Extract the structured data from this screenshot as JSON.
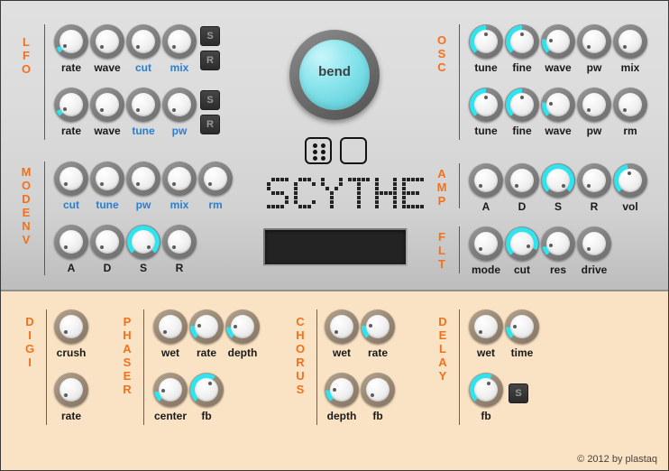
{
  "app": {
    "name": "SCYTHE",
    "logo_text": "SCYTHE",
    "copyright": "© 2012 by plastaq"
  },
  "colors": {
    "accent_orange": "#f4711c",
    "arc_cyan": "#2fe3ef",
    "mod_label_blue": "#2a7fd4",
    "top_panel_bg": "#dcdcdc",
    "bottom_panel_bg": "#fae3c4",
    "knob_ring_gray": "#808080",
    "knob_ring_tan": "#9b8a76",
    "bend_cyan": "#8fe6ee",
    "lcd_bg": "#232323"
  },
  "center": {
    "bend_label": "bend",
    "dice_button": "dice-icon",
    "blank_button": "square-icon",
    "lcd_text": ""
  },
  "sections": [
    {
      "id": "lfo",
      "label": "LFO",
      "panel": "top",
      "knobs": [
        {
          "label": "rate",
          "style": "plain",
          "value": 8,
          "angle": -125
        },
        {
          "label": "wave",
          "style": "plain",
          "value": 0,
          "angle": -135
        },
        {
          "label": "cut",
          "style": "mod",
          "value": 0,
          "angle": -135
        },
        {
          "label": "mix",
          "style": "mod",
          "value": 0,
          "angle": -135
        },
        {
          "label": "rate",
          "style": "plain",
          "value": 8,
          "angle": -125
        },
        {
          "label": "wave",
          "style": "plain",
          "value": 0,
          "angle": -135
        },
        {
          "label": "tune",
          "style": "mod",
          "value": 0,
          "angle": -135
        },
        {
          "label": "pw",
          "style": "mod",
          "value": 0,
          "angle": -135
        }
      ],
      "buttons": [
        "S",
        "R",
        "S",
        "R"
      ]
    },
    {
      "id": "mod-env",
      "label": "MOD ENV",
      "panel": "top",
      "knobs": [
        {
          "label": "cut",
          "style": "mod",
          "value": 0,
          "angle": -135
        },
        {
          "label": "tune",
          "style": "mod",
          "value": 0,
          "angle": -135
        },
        {
          "label": "pw",
          "style": "mod",
          "value": 0,
          "angle": -135
        },
        {
          "label": "mix",
          "style": "mod",
          "value": 0,
          "angle": -135
        },
        {
          "label": "rm",
          "style": "mod",
          "value": 0,
          "angle": -135
        },
        {
          "label": "A",
          "style": "plain",
          "value": 0,
          "angle": -135
        },
        {
          "label": "D",
          "style": "plain",
          "value": 0,
          "angle": -135
        },
        {
          "label": "S",
          "style": "plain",
          "value": 100,
          "angle": 135
        },
        {
          "label": "R",
          "style": "plain",
          "value": 0,
          "angle": -135
        }
      ],
      "buttons": []
    },
    {
      "id": "osc",
      "label": "OSC",
      "panel": "top",
      "knobs": [
        {
          "label": "tune",
          "style": "plain",
          "value": 50,
          "angle": 0
        },
        {
          "label": "fine",
          "style": "plain",
          "value": 50,
          "angle": 0
        },
        {
          "label": "wave",
          "style": "plain",
          "value": 20,
          "angle": -81
        },
        {
          "label": "pw",
          "style": "plain",
          "value": 0,
          "angle": -135
        },
        {
          "label": "mix",
          "style": "plain",
          "value": 0,
          "angle": -135
        },
        {
          "label": "tune",
          "style": "plain",
          "value": 50,
          "angle": 0
        },
        {
          "label": "fine",
          "style": "plain",
          "value": 50,
          "angle": 0
        },
        {
          "label": "wave",
          "style": "plain",
          "value": 20,
          "angle": -81
        },
        {
          "label": "pw",
          "style": "plain",
          "value": 0,
          "angle": -135
        },
        {
          "label": "rm",
          "style": "plain",
          "value": 0,
          "angle": -135
        }
      ],
      "buttons": []
    },
    {
      "id": "amp",
      "label": "AMP",
      "panel": "top",
      "knobs": [
        {
          "label": "A",
          "style": "plain",
          "value": 0,
          "angle": -135
        },
        {
          "label": "D",
          "style": "plain",
          "value": 0,
          "angle": -135
        },
        {
          "label": "S",
          "style": "plain",
          "value": 100,
          "angle": 135
        },
        {
          "label": "R",
          "style": "plain",
          "value": 0,
          "angle": -135
        },
        {
          "label": "vol",
          "style": "plain",
          "value": 46,
          "angle": -11
        }
      ],
      "buttons": []
    },
    {
      "id": "flt",
      "label": "FLT",
      "panel": "top",
      "knobs": [
        {
          "label": "mode",
          "style": "plain",
          "value": 0,
          "angle": -135
        },
        {
          "label": "cut",
          "style": "plain",
          "value": 92,
          "angle": 113
        },
        {
          "label": "res",
          "style": "plain",
          "value": 12,
          "angle": -103
        },
        {
          "label": "drive",
          "style": "plain",
          "value": 0,
          "angle": -135
        }
      ],
      "buttons": []
    },
    {
      "id": "digi",
      "label": "DIGI",
      "panel": "bottom",
      "knobs": [
        {
          "label": "crush",
          "style": "plain",
          "value": 0,
          "angle": -135
        },
        {
          "label": "rate",
          "style": "plain",
          "value": 0,
          "angle": -135
        }
      ],
      "buttons": []
    },
    {
      "id": "phaser",
      "label": "PHASER",
      "panel": "bottom",
      "knobs": [
        {
          "label": "wet",
          "style": "plain",
          "value": 0,
          "angle": -135
        },
        {
          "label": "rate",
          "style": "plain",
          "value": 18,
          "angle": -86
        },
        {
          "label": "depth",
          "style": "plain",
          "value": 16,
          "angle": -92
        },
        {
          "label": "center",
          "style": "plain",
          "value": 14,
          "angle": -98
        },
        {
          "label": "fb",
          "style": "plain",
          "value": 62,
          "angle": 32
        }
      ],
      "buttons": []
    },
    {
      "id": "chorus",
      "label": "CHORUS",
      "panel": "bottom",
      "knobs": [
        {
          "label": "wet",
          "style": "plain",
          "value": 0,
          "angle": -135
        },
        {
          "label": "rate",
          "style": "plain",
          "value": 18,
          "angle": -86
        },
        {
          "label": "depth",
          "style": "plain",
          "value": 16,
          "angle": -92
        },
        {
          "label": "fb",
          "style": "plain",
          "value": 0,
          "angle": -135
        }
      ],
      "buttons": []
    },
    {
      "id": "delay",
      "label": "DELAY",
      "panel": "bottom",
      "knobs": [
        {
          "label": "wet",
          "style": "plain",
          "value": 0,
          "angle": -135
        },
        {
          "label": "time",
          "style": "plain",
          "value": 16,
          "angle": -92
        },
        {
          "label": "fb",
          "style": "plain",
          "value": 58,
          "angle": 22
        }
      ],
      "buttons": [
        "S"
      ]
    }
  ]
}
